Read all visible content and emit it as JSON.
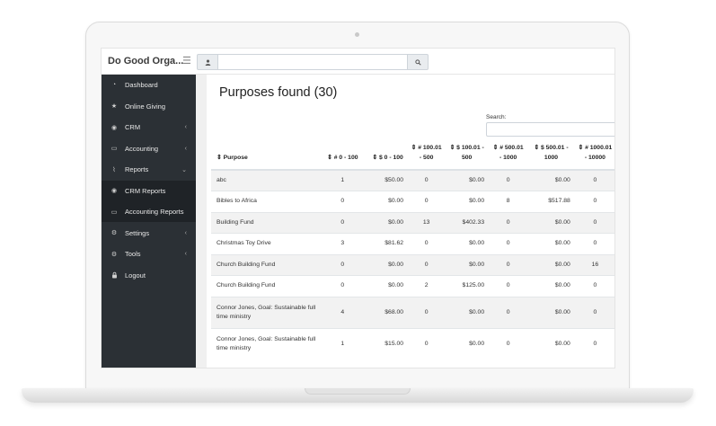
{
  "app": {
    "brand": "Do Good Orga...",
    "hamburger_icon": "☰"
  },
  "sidebar": {
    "items": [
      {
        "label": "Dashboard",
        "icon": "dashboard-icon",
        "glyph": "◔"
      },
      {
        "label": "Online Giving",
        "icon": "star-icon",
        "glyph": "★"
      },
      {
        "label": "CRM",
        "icon": "user-circle-icon",
        "glyph": "◉",
        "chevron": "‹"
      },
      {
        "label": "Accounting",
        "icon": "credit-card-icon",
        "glyph": "▭",
        "chevron": "‹"
      },
      {
        "label": "Reports",
        "icon": "line-chart-icon",
        "glyph": "⌇",
        "chevron": "⌄"
      },
      {
        "label": "CRM Reports",
        "icon": "user-circle-icon",
        "glyph": "◉"
      },
      {
        "label": "Accounting Reports",
        "icon": "credit-card-icon",
        "glyph": "▭"
      },
      {
        "label": "Settings",
        "icon": "cogs-icon",
        "glyph": "⚙",
        "chevron": "‹"
      },
      {
        "label": "Tools",
        "icon": "cogs-icon",
        "glyph": "⚙",
        "chevron": "‹"
      },
      {
        "label": "Logout",
        "icon": "lock-icon",
        "glyph": "🔒"
      }
    ]
  },
  "main": {
    "title": "Purposes found (30)",
    "search_label": "Search:",
    "table": {
      "headers": [
        {
          "sort": "⇕",
          "label": "Purpose"
        },
        {
          "sort": "⇕",
          "label": "# 0 - 100"
        },
        {
          "sort": "⇕",
          "label": "$ 0 - 100"
        },
        {
          "sort": "⇕",
          "label": "# 100.01 - 500"
        },
        {
          "sort": "⇕",
          "label": "$ 100.01 - 500"
        },
        {
          "sort": "⇕",
          "label": "# 500.01 - 1000"
        },
        {
          "sort": "⇕",
          "label": "$ 500.01 - 1000"
        },
        {
          "sort": "⇕",
          "label": "# 1000.01 - 10000"
        }
      ],
      "rows": [
        [
          "abc",
          "1",
          "$50.00",
          "0",
          "$0.00",
          "0",
          "$0.00",
          "0"
        ],
        [
          "Bibles to Africa",
          "0",
          "$0.00",
          "0",
          "$0.00",
          "8",
          "$517.88",
          "0"
        ],
        [
          "Building Fund",
          "0",
          "$0.00",
          "13",
          "$402.33",
          "0",
          "$0.00",
          "0"
        ],
        [
          "Christmas Toy Drive",
          "3",
          "$81.62",
          "0",
          "$0.00",
          "0",
          "$0.00",
          "0"
        ],
        [
          "Church Building Fund",
          "0",
          "$0.00",
          "0",
          "$0.00",
          "0",
          "$0.00",
          "16"
        ],
        [
          "Church Building Fund",
          "0",
          "$0.00",
          "2",
          "$125.00",
          "0",
          "$0.00",
          "0"
        ],
        [
          "Connor Jones, Goal: Sustainable full time ministry",
          "4",
          "$68.00",
          "0",
          "$0.00",
          "0",
          "$0.00",
          "0"
        ],
        [
          "Connor Jones, Goal: Sustainable full time ministry",
          "1",
          "$15.00",
          "0",
          "$0.00",
          "0",
          "$0.00",
          "0"
        ]
      ]
    }
  }
}
